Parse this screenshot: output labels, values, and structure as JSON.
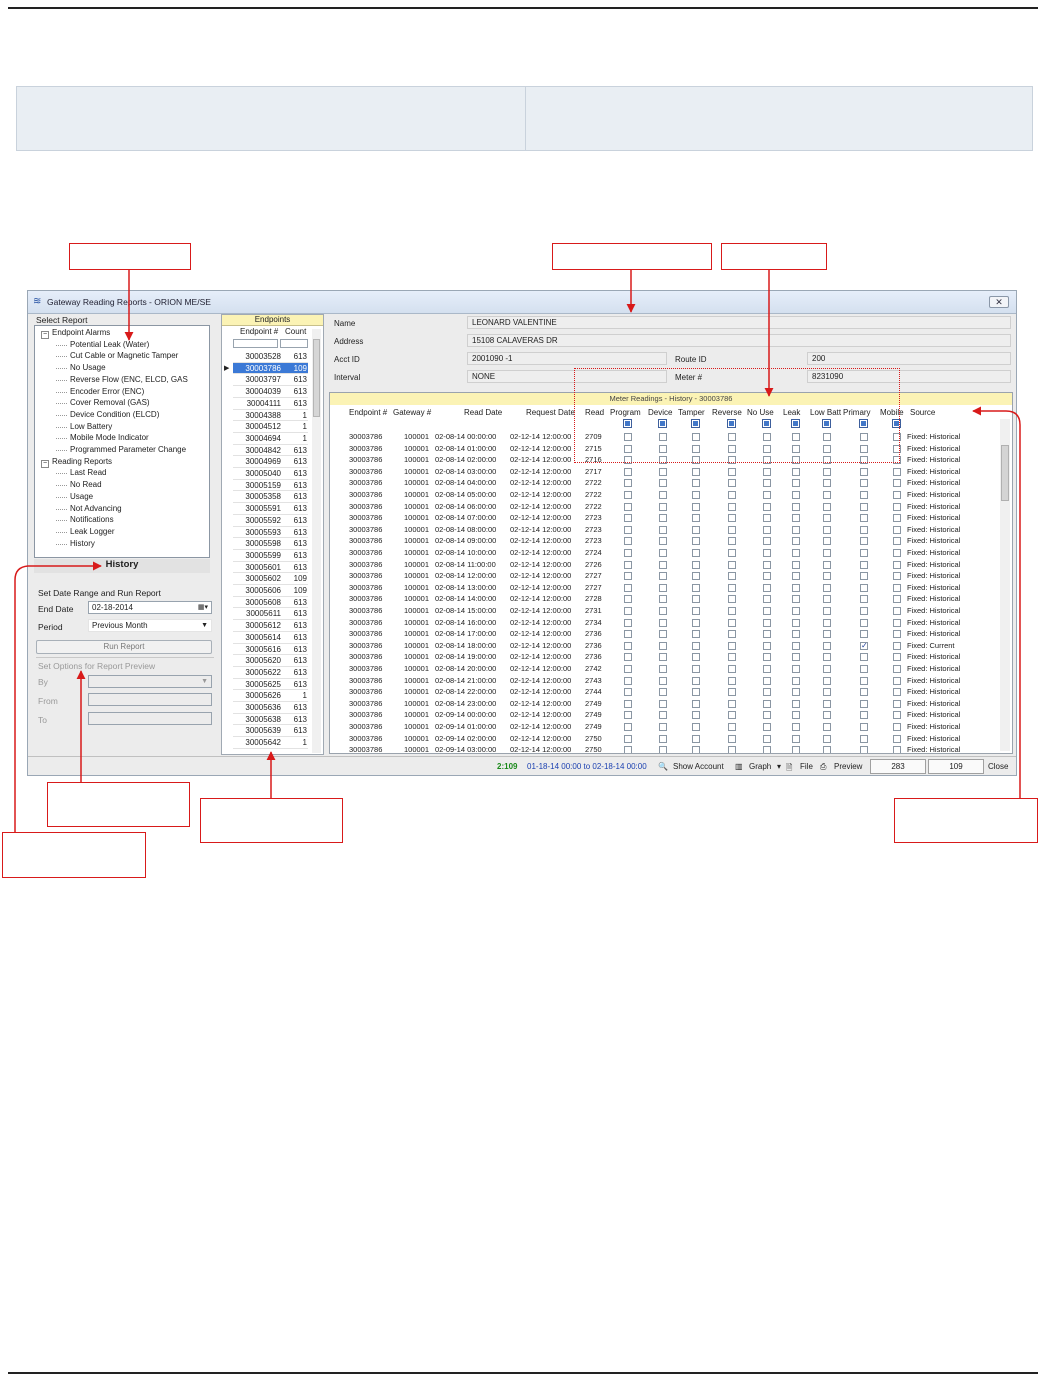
{
  "window": {
    "title": "Gateway Reading Reports - ORION ME/SE",
    "close_icon": "close-icon"
  },
  "select_report": {
    "label": "Select Report",
    "tree": [
      {
        "text": "Endpoint Alarms",
        "level": 0
      },
      {
        "text": "Potential Leak (Water)",
        "level": 1
      },
      {
        "text": "Cut Cable or Magnetic Tamper",
        "level": 1
      },
      {
        "text": "No Usage",
        "level": 1
      },
      {
        "text": "Reverse Flow (ENC, ELCD, GAS",
        "level": 1
      },
      {
        "text": "Encoder Error (ENC)",
        "level": 1
      },
      {
        "text": "Cover Removal (GAS)",
        "level": 1
      },
      {
        "text": "Device Condition (ELCD)",
        "level": 1
      },
      {
        "text": "Low Battery",
        "level": 1
      },
      {
        "text": "Mobile Mode Indicator",
        "level": 1
      },
      {
        "text": "Programmed Parameter Change",
        "level": 1
      },
      {
        "text": "Reading Reports",
        "level": 0
      },
      {
        "text": "Last Read",
        "level": 1
      },
      {
        "text": "No Read",
        "level": 1
      },
      {
        "text": "Usage",
        "level": 1
      },
      {
        "text": "Not Advancing",
        "level": 1
      },
      {
        "text": "Notifications",
        "level": 1
      },
      {
        "text": "Leak Logger",
        "level": 1
      },
      {
        "text": "History",
        "level": 1
      }
    ],
    "selected_tab": "History"
  },
  "date_range": {
    "heading": "Set Date Range and Run Report",
    "end_date_label": "End Date",
    "end_date_value": "02-18-2014",
    "period_label": "Period",
    "period_value": "Previous Month",
    "run_button": "Run Report"
  },
  "options": {
    "heading": "Set Options for Report Preview",
    "by_label": "By",
    "from_label": "From",
    "to_label": "To"
  },
  "endpoints": {
    "header": "Endpoints",
    "col_endpoint": "Endpoint #",
    "col_count": "Count",
    "rows": [
      [
        "30003528",
        "613"
      ],
      [
        "30003786",
        "109"
      ],
      [
        "30003797",
        "613"
      ],
      [
        "30004039",
        "613"
      ],
      [
        "30004111",
        "613"
      ],
      [
        "30004388",
        "1"
      ],
      [
        "30004512",
        "1"
      ],
      [
        "30004694",
        "1"
      ],
      [
        "30004842",
        "613"
      ],
      [
        "30004969",
        "613"
      ],
      [
        "30005040",
        "613"
      ],
      [
        "30005159",
        "613"
      ],
      [
        "30005358",
        "613"
      ],
      [
        "30005591",
        "613"
      ],
      [
        "30005592",
        "613"
      ],
      [
        "30005593",
        "613"
      ],
      [
        "30005598",
        "613"
      ],
      [
        "30005599",
        "613"
      ],
      [
        "30005601",
        "613"
      ],
      [
        "30005602",
        "109"
      ],
      [
        "30005606",
        "109"
      ],
      [
        "30005608",
        "613"
      ],
      [
        "30005611",
        "613"
      ],
      [
        "30005612",
        "613"
      ],
      [
        "30005614",
        "613"
      ],
      [
        "30005616",
        "613"
      ],
      [
        "30005620",
        "613"
      ],
      [
        "30005622",
        "613"
      ],
      [
        "30005625",
        "613"
      ],
      [
        "30005626",
        "1"
      ],
      [
        "30005636",
        "613"
      ],
      [
        "30005638",
        "613"
      ],
      [
        "30005639",
        "613"
      ],
      [
        "30005642",
        "1"
      ]
    ],
    "selected_index": 1
  },
  "account": {
    "name_label": "Name",
    "name_value": "LEONARD    VALENTINE",
    "address_label": "Address",
    "address_value": "15108 CALAVERAS DR",
    "acct_label": "Acct ID",
    "acct_value": "2001090  -1",
    "route_label": "Route ID",
    "route_value": "200",
    "interval_label": "Interval",
    "interval_value": "NONE",
    "meter_label": "Meter #",
    "meter_value": "8231090"
  },
  "readings": {
    "title": "Meter Readings - History - 30003786",
    "columns": [
      "Endpoint #",
      "Gateway #",
      "Read Date",
      "Request Date",
      "Read",
      "Program",
      "Device",
      "Tamper",
      "Reverse",
      "No Use",
      "Leak",
      "Low Batt",
      "Primary",
      "Mobile",
      "Source"
    ],
    "rows": [
      [
        "30003786",
        "100001",
        "02-08-14 00:00:00",
        "02-12-14 12:00:00",
        "2709",
        "Fixed: Historical",
        false
      ],
      [
        "30003786",
        "100001",
        "02-08-14 01:00:00",
        "02-12-14 12:00:00",
        "2715",
        "Fixed: Historical",
        false
      ],
      [
        "30003786",
        "100001",
        "02-08-14 02:00:00",
        "02-12-14 12:00:00",
        "2716",
        "Fixed: Historical",
        false
      ],
      [
        "30003786",
        "100001",
        "02-08-14 03:00:00",
        "02-12-14 12:00:00",
        "2717",
        "Fixed: Historical",
        false
      ],
      [
        "30003786",
        "100001",
        "02-08-14 04:00:00",
        "02-12-14 12:00:00",
        "2722",
        "Fixed: Historical",
        false
      ],
      [
        "30003786",
        "100001",
        "02-08-14 05:00:00",
        "02-12-14 12:00:00",
        "2722",
        "Fixed: Historical",
        false
      ],
      [
        "30003786",
        "100001",
        "02-08-14 06:00:00",
        "02-12-14 12:00:00",
        "2722",
        "Fixed: Historical",
        false
      ],
      [
        "30003786",
        "100001",
        "02-08-14 07:00:00",
        "02-12-14 12:00:00",
        "2723",
        "Fixed: Historical",
        false
      ],
      [
        "30003786",
        "100001",
        "02-08-14 08:00:00",
        "02-12-14 12:00:00",
        "2723",
        "Fixed: Historical",
        false
      ],
      [
        "30003786",
        "100001",
        "02-08-14 09:00:00",
        "02-12-14 12:00:00",
        "2723",
        "Fixed: Historical",
        false
      ],
      [
        "30003786",
        "100001",
        "02-08-14 10:00:00",
        "02-12-14 12:00:00",
        "2724",
        "Fixed: Historical",
        false
      ],
      [
        "30003786",
        "100001",
        "02-08-14 11:00:00",
        "02-12-14 12:00:00",
        "2726",
        "Fixed: Historical",
        false
      ],
      [
        "30003786",
        "100001",
        "02-08-14 12:00:00",
        "02-12-14 12:00:00",
        "2727",
        "Fixed: Historical",
        false
      ],
      [
        "30003786",
        "100001",
        "02-08-14 13:00:00",
        "02-12-14 12:00:00",
        "2727",
        "Fixed: Historical",
        false
      ],
      [
        "30003786",
        "100001",
        "02-08-14 14:00:00",
        "02-12-14 12:00:00",
        "2728",
        "Fixed: Historical",
        false
      ],
      [
        "30003786",
        "100001",
        "02-08-14 15:00:00",
        "02-12-14 12:00:00",
        "2731",
        "Fixed: Historical",
        false
      ],
      [
        "30003786",
        "100001",
        "02-08-14 16:00:00",
        "02-12-14 12:00:00",
        "2734",
        "Fixed: Historical",
        false
      ],
      [
        "30003786",
        "100001",
        "02-08-14 17:00:00",
        "02-12-14 12:00:00",
        "2736",
        "Fixed: Historical",
        false
      ],
      [
        "30003786",
        "100001",
        "02-08-14 18:00:00",
        "02-12-14 12:00:00",
        "2736",
        "Fixed: Current",
        true
      ],
      [
        "30003786",
        "100001",
        "02-08-14 19:00:00",
        "02-12-14 12:00:00",
        "2736",
        "Fixed: Historical",
        false
      ],
      [
        "30003786",
        "100001",
        "02-08-14 20:00:00",
        "02-12-14 12:00:00",
        "2742",
        "Fixed: Historical",
        false
      ],
      [
        "30003786",
        "100001",
        "02-08-14 21:00:00",
        "02-12-14 12:00:00",
        "2743",
        "Fixed: Historical",
        false
      ],
      [
        "30003786",
        "100001",
        "02-08-14 22:00:00",
        "02-12-14 12:00:00",
        "2744",
        "Fixed: Historical",
        false
      ],
      [
        "30003786",
        "100001",
        "02-08-14 23:00:00",
        "02-12-14 12:00:00",
        "2749",
        "Fixed: Historical",
        false
      ],
      [
        "30003786",
        "100001",
        "02-09-14 00:00:00",
        "02-12-14 12:00:00",
        "2749",
        "Fixed: Historical",
        false
      ],
      [
        "30003786",
        "100001",
        "02-09-14 01:00:00",
        "02-12-14 12:00:00",
        "2749",
        "Fixed: Historical",
        false
      ],
      [
        "30003786",
        "100001",
        "02-09-14 02:00:00",
        "02-12-14 12:00:00",
        "2750",
        "Fixed: Historical",
        false
      ],
      [
        "30003786",
        "100001",
        "02-09-14 03:00:00",
        "02-12-14 12:00:00",
        "2750",
        "Fixed: Historical",
        false
      ]
    ]
  },
  "statusbar": {
    "count": "2:109",
    "range": "01-18-14 00:00 to 02-18-14 00:00",
    "show_account": "Show Account",
    "graph": "Graph",
    "file": "File",
    "preview": "Preview",
    "box1": "283",
    "box2": "109",
    "close": "Close"
  }
}
